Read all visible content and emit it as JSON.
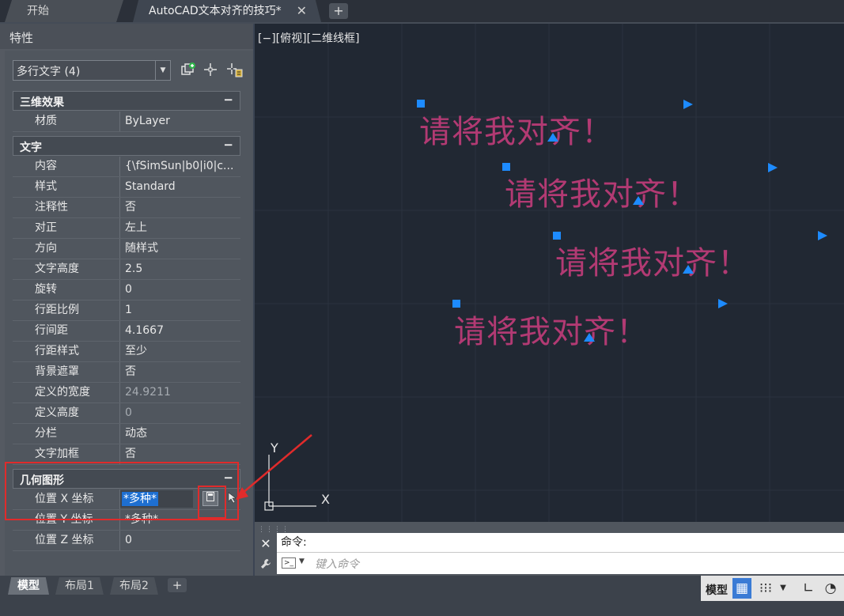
{
  "tabs": {
    "start": "开始",
    "document": "AutoCAD文本对齐的技巧*",
    "close_glyph": "✕",
    "new_glyph": "+"
  },
  "palette": {
    "title": "特性",
    "selection": "多行文字 (4)",
    "sections": {
      "three_d": {
        "title": "三维效果",
        "rows": [
          {
            "name": "材质",
            "value": "ByLayer"
          }
        ]
      },
      "text": {
        "title": "文字",
        "rows": [
          {
            "name": "内容",
            "value": "{\\fSimSun|b0|i0|c..."
          },
          {
            "name": "样式",
            "value": "Standard"
          },
          {
            "name": "注释性",
            "value": "否"
          },
          {
            "name": "对正",
            "value": "左上"
          },
          {
            "name": "方向",
            "value": "随样式"
          },
          {
            "name": "文字高度",
            "value": "2.5"
          },
          {
            "name": "旋转",
            "value": "0"
          },
          {
            "name": "行距比例",
            "value": "1"
          },
          {
            "name": "行间距",
            "value": "4.1667"
          },
          {
            "name": "行距样式",
            "value": "至少"
          },
          {
            "name": "背景遮罩",
            "value": "否"
          },
          {
            "name": "定义的宽度",
            "value": "24.9211"
          },
          {
            "name": "定义高度",
            "value": "0"
          },
          {
            "name": "分栏",
            "value": "动态"
          },
          {
            "name": "文字加框",
            "value": "否"
          }
        ]
      },
      "geometry": {
        "title": "几何图形",
        "rows": [
          {
            "name": "位置 X 坐标",
            "value": "*多种*"
          },
          {
            "name": "位置 Y 坐标",
            "value": "*多种*"
          },
          {
            "name": "位置 Z 坐标",
            "value": "0"
          }
        ]
      }
    }
  },
  "viewport": {
    "label": "[−][俯视][二维线框]",
    "texts": [
      "请将我对齐！",
      "请将我对齐！",
      "请将我对齐！",
      "请将我对齐！"
    ],
    "ucs_y": "Y",
    "ucs_x": "X"
  },
  "command": {
    "history": "命令:",
    "placeholder": "键入命令"
  },
  "layout_tabs": [
    "模型",
    "布局1",
    "布局2"
  ],
  "status": {
    "model": "模型"
  },
  "colors": {
    "mtext": "#b23a73",
    "grip": "#1d8bff",
    "annotation": "#e02b2b"
  }
}
